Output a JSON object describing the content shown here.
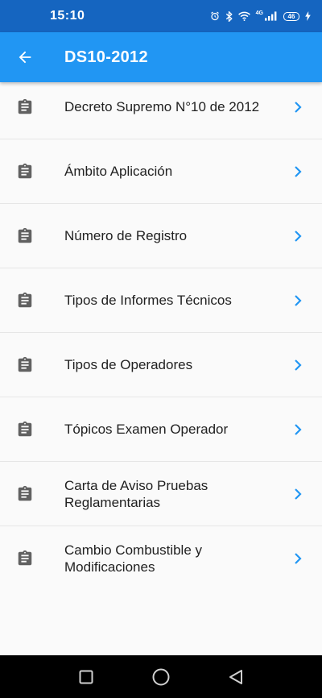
{
  "status_bar": {
    "time": "15:10",
    "network_label": "4G",
    "battery": "46",
    "icons": [
      "alarm-icon",
      "bluetooth-icon",
      "wifi-icon",
      "signal-icon",
      "battery-icon",
      "charging-icon"
    ]
  },
  "app_bar": {
    "title": "DS10-2012",
    "back_icon": "arrow-back-icon",
    "color": "#2196f3"
  },
  "colors": {
    "status_bar": "#1565c0",
    "accent": "#2196f3",
    "icon": "#616161"
  },
  "list": {
    "items": [
      {
        "label": "Decreto Supremo N°10 de 2012",
        "icon": "clipboard-icon"
      },
      {
        "label": "Ámbito Aplicación",
        "icon": "clipboard-icon"
      },
      {
        "label": "Número de Registro",
        "icon": "clipboard-icon"
      },
      {
        "label": "Tipos de Informes Técnicos",
        "icon": "clipboard-icon"
      },
      {
        "label": "Tipos de Operadores",
        "icon": "clipboard-icon"
      },
      {
        "label": "Tópicos Examen Operador",
        "icon": "clipboard-icon"
      },
      {
        "label": "Carta de Aviso Pruebas Reglamentarias",
        "icon": "clipboard-icon"
      },
      {
        "label": "Cambio Combustible y Modificaciones",
        "icon": "clipboard-icon"
      }
    ]
  },
  "nav_bar": {
    "buttons": [
      "recents-square-icon",
      "home-circle-icon",
      "back-triangle-icon"
    ]
  }
}
